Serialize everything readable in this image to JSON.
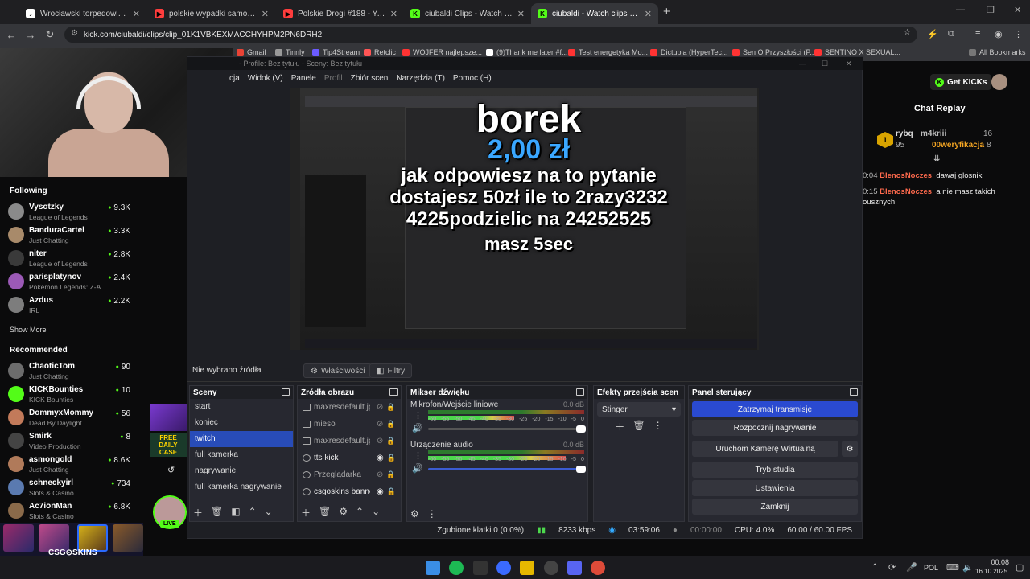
{
  "browser": {
    "tabs": [
      {
        "title": "Wrocławski torpedowiec. #zony",
        "color": "#ffffff"
      },
      {
        "title": "polskie wypadki samochodowe",
        "color": "#ff3d3d"
      },
      {
        "title": "Polskie Drogi #188 - YouTube",
        "color": "#ff3d3d"
      },
      {
        "title": "ciubaldi Clips - Watch Live on K",
        "color": "#53fc18"
      },
      {
        "title": "ciubaldi - Watch clips on Kick",
        "color": "#53fc18"
      }
    ],
    "url": "kick.com/ciubaldi/clips/clip_01K1VBKEXMACCHYHPM2PN6DRH2",
    "bookmarks": [
      "Gmail",
      "Tinnly",
      "Tip4Stream",
      "Retclic",
      "WOJFER najlepsze...",
      "(9)Thank me later #f...",
      "Test energetyka Mo...",
      "Dictubia (HyperTec...",
      "Sen O Przyszłości (P...",
      "SENTINO X SEXUAL..."
    ],
    "all_bookmarks": "All Bookmarks"
  },
  "sidebar": {
    "following_title": "Following",
    "following": [
      {
        "name": "Vysotzky",
        "game": "League of Legends",
        "viewers": "9.3K",
        "color": "#8a8a8a"
      },
      {
        "name": "BanduraCartel",
        "game": "Just Chatting",
        "viewers": "3.3K",
        "color": "#a88a6a"
      },
      {
        "name": "niter",
        "game": "League of Legends",
        "viewers": "2.8K",
        "color": "#3a3a3a"
      },
      {
        "name": "parisplatynov",
        "game": "Pokemon Legends: Z-A",
        "viewers": "2.4K",
        "color": "#9b59b6"
      },
      {
        "name": "Azdus",
        "game": "IRL",
        "viewers": "2.2K",
        "color": "#7d7d7d"
      }
    ],
    "show_more": "Show More",
    "recommended_title": "Recommended",
    "recommended": [
      {
        "name": "ChaoticTom",
        "game": "Just Chatting",
        "viewers": "90",
        "color": "#6c6c6c"
      },
      {
        "name": "KICKBounties",
        "game": "KICK Bounties",
        "viewers": "10",
        "color": "#53fc18"
      },
      {
        "name": "DommyxMommy",
        "game": "Dead By Daylight",
        "viewers": "56",
        "color": "#c27a5a"
      },
      {
        "name": "Smirk",
        "game": "Video Production",
        "viewers": "8",
        "color": "#444"
      },
      {
        "name": "asmongold",
        "game": "Just Chatting",
        "viewers": "8.6K",
        "color": "#b07a5a"
      },
      {
        "name": "schneckyirl",
        "game": "Slots & Casino",
        "viewers": "734",
        "color": "#5a7ab0"
      },
      {
        "name": "Ac7ionMan",
        "game": "Slots & Casino",
        "viewers": "6.8K",
        "color": "#8a6a4a"
      }
    ]
  },
  "promo": {
    "brand": "CSG⊙SKINS",
    "badge_line1": "FREE",
    "badge_line2": "DAILY",
    "badge_line3": "CASE",
    "live": "LIVE"
  },
  "obs": {
    "title": "- Profile: Bez tytułu - Sceny: Bez tytułu",
    "menu": [
      "cja",
      "Widok (V)",
      "Panele",
      "Profil",
      "Zbiór scen",
      "Narzędzia (T)",
      "Pomoc (H)"
    ],
    "overlay": {
      "name": "borek",
      "amount": "2,00 zł",
      "question_l1": "jak odpowiesz na to pytanie",
      "question_l2": "dostajesz 50zł ile to 2razy3232",
      "question_l3": "4225podzielic na 24252525",
      "timer": "masz 5sec"
    },
    "no_source": "Nie wybrano źródła",
    "properties": "Właściwości",
    "filters": "Filtry",
    "scenes_title": "Sceny",
    "scenes": [
      "start",
      "koniec",
      "twitch",
      "full kamerka",
      "nagrywanie",
      "full kamerka nagrywanie"
    ],
    "sources_title": "Źródła obrazu",
    "sources": [
      {
        "name": "maxresdefault.jp",
        "visible": false
      },
      {
        "name": "mieso",
        "visible": false
      },
      {
        "name": "maxresdefault.jp",
        "visible": false
      },
      {
        "name": "tts kick",
        "visible": true
      },
      {
        "name": "Przeglądarka",
        "visible": false
      },
      {
        "name": "csgoskins banne",
        "visible": true
      }
    ],
    "mixer_title": "Mikser dźwięku",
    "mixer": [
      {
        "name": "Mikrofon/Wejście liniowe",
        "db": "0.0 dB",
        "level": 0.55
      },
      {
        "name": "Urządzenie audio",
        "db": "0.0 dB",
        "level": 0.88
      }
    ],
    "mixer_ticks": [
      "-60",
      "-55",
      "-50",
      "-45",
      "-40",
      "-35",
      "-30",
      "-25",
      "-20",
      "-15",
      "-10",
      "-5",
      "0"
    ],
    "transitions_title": "Efekty przejścia scen",
    "transition": "Stinger",
    "controls_title": "Panel sterujący",
    "controls": [
      "Zatrzymaj transmisję",
      "Rozpocznij nagrywanie",
      "Uruchom Kamerę Wirtualną",
      "Tryb studia",
      "Ustawienia",
      "Zamknij"
    ],
    "status": {
      "dropped": "Zgubione klatki 0 (0.0%)",
      "bitrate": "8233 kbps",
      "stream_time": "03:59:06",
      "rec_time": "00:00:00",
      "cpu": "CPU: 4.0%",
      "fps": "60.00 / 60.00 FPS"
    }
  },
  "chat": {
    "get_kicks": "Get KICKs",
    "title": "Chat Replay",
    "leaderboard": [
      {
        "rank": "1",
        "name": "rybq",
        "points": "95"
      },
      {
        "name": "m4kriii",
        "points": "16"
      },
      {
        "name": "00weryfikacja",
        "points": "8"
      }
    ],
    "messages": [
      {
        "time": "0:04",
        "user": "BlenosNoczes",
        "text": ": dawaj glosniki"
      },
      {
        "time": "0:15",
        "user": "BlenosNoczes",
        "text": ": a nie masz takich",
        "cont": "ousznych"
      }
    ]
  },
  "taskbar": {
    "lang": "POL",
    "time": "00:08",
    "date": "16.10.2025"
  }
}
